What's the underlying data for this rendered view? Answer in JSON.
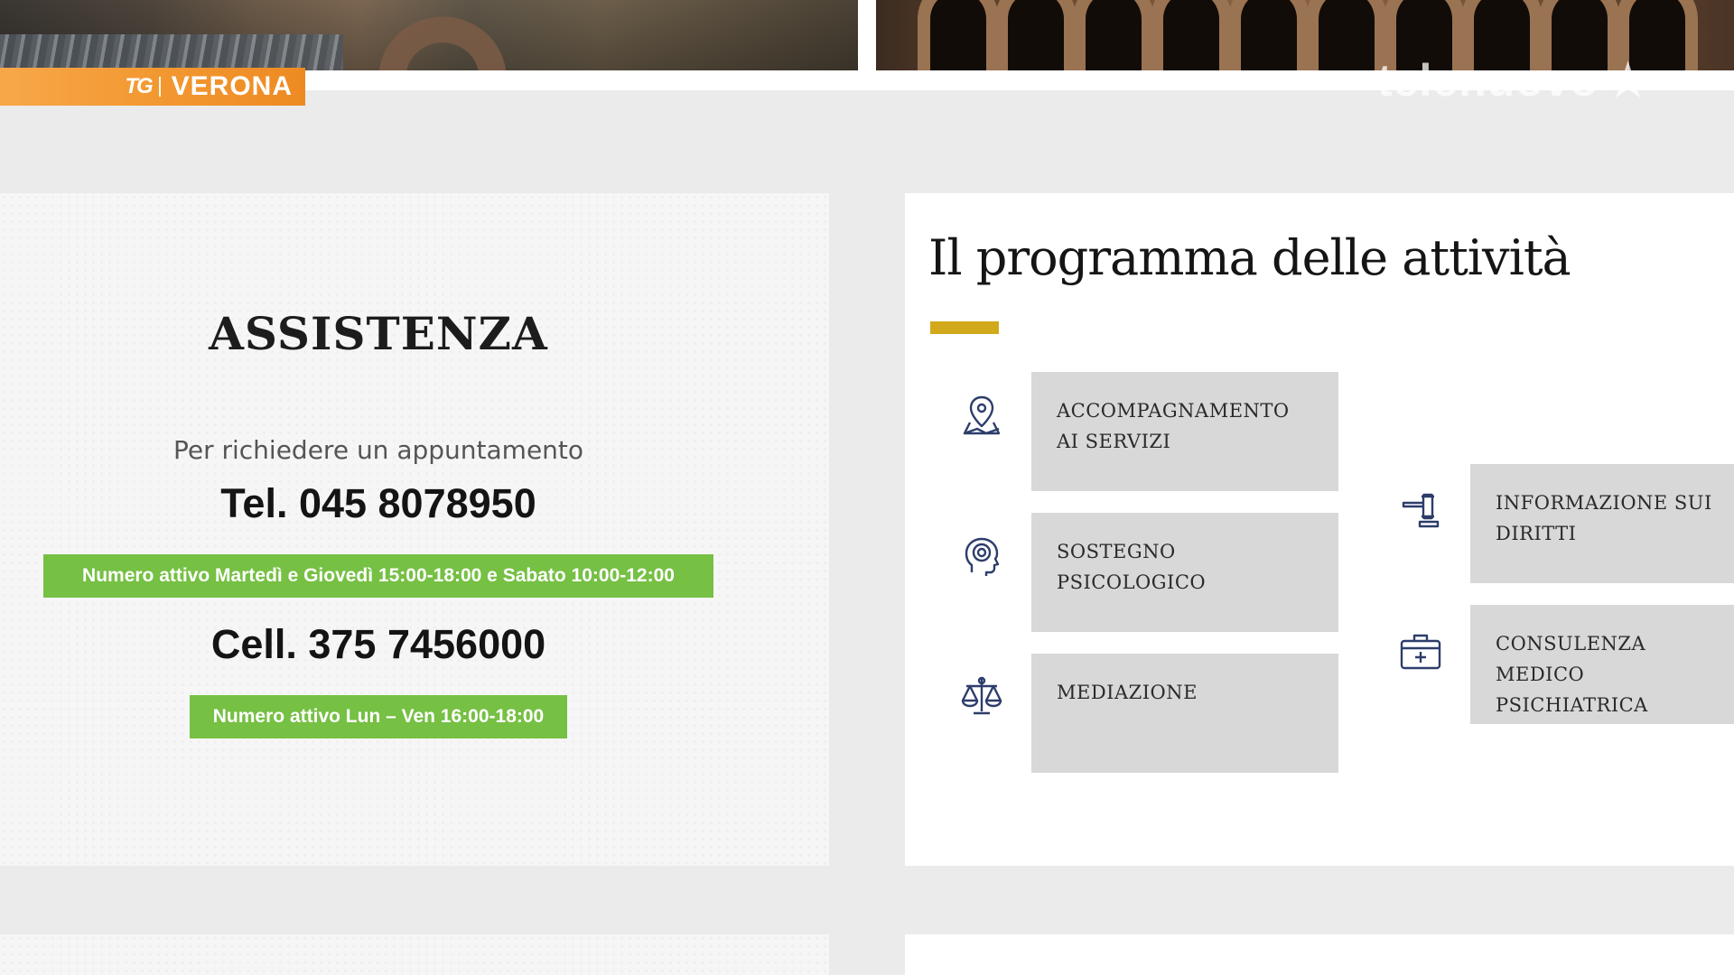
{
  "channel_badge": {
    "logo": "TG",
    "city": "VERONA"
  },
  "watermark": {
    "text": "telenuovo",
    "icon": "star-icon"
  },
  "assistance": {
    "title": "ASSISTENZA",
    "subtitle": "Per richiedere un appuntamento",
    "phone": "Tel. 045 8078950",
    "phone_hours": "Numero attivo Martedì e Giovedì 15:00-18:00 e Sabato 10:00-12:00",
    "mobile": "Cell. 375 7456000",
    "mobile_hours": "Numero attivo Lun – Ven 16:00-18:00",
    "accent_color": "#76c044"
  },
  "program": {
    "title": "Il programma delle attività",
    "accent_color": "#d2a91b",
    "activities": [
      {
        "label": "ACCOMPAGNAMENTO AI SERVIZI",
        "icon": "map-pin-icon"
      },
      {
        "label": "SOSTEGNO PSICOLOGICO",
        "icon": "head-mind-icon"
      },
      {
        "label": "MEDIAZIONE",
        "icon": "balance-scale-icon"
      },
      {
        "label": "INFORMAZIONE SUI DIRITTI",
        "icon": "gavel-icon"
      },
      {
        "label": "CONSULENZA MEDICO PSICHIATRICA",
        "icon": "medical-kit-icon"
      }
    ]
  }
}
